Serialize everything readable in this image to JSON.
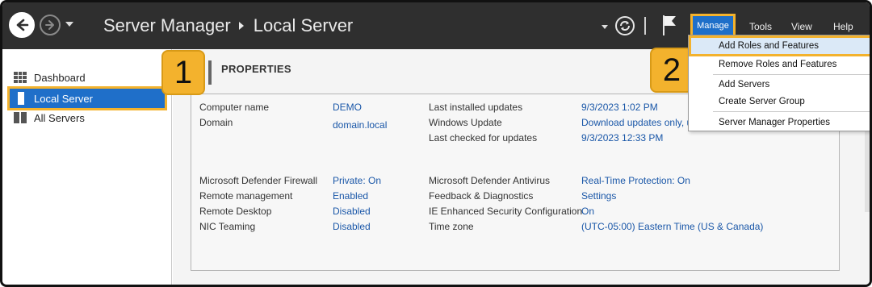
{
  "titlebar": {
    "breadcrumb_root": "Server Manager",
    "breadcrumb_current": "Local Server",
    "menus": {
      "manage": "Manage",
      "tools": "Tools",
      "view": "View",
      "help": "Help"
    },
    "icons": [
      "back-arrow-icon",
      "forward-arrow-icon",
      "refresh-icon",
      "flag-icon"
    ]
  },
  "sidebar": {
    "items": [
      {
        "label": "Dashboard",
        "icon": "dashboard-grid-icon"
      },
      {
        "label": "Local Server",
        "icon": "local-server-icon",
        "selected": true
      },
      {
        "label": "All Servers",
        "icon": "all-servers-icon"
      }
    ]
  },
  "callouts": {
    "one": "1",
    "two": "2"
  },
  "properties": {
    "title": "PROPERTIES",
    "left_top": [
      {
        "label": "Computer name",
        "value": "DEMO"
      },
      {
        "label": "Domain",
        "value": "domain.local"
      }
    ],
    "right_top": [
      {
        "label": "Last installed updates",
        "value": "9/3/2023 1:02 PM"
      },
      {
        "label": "Windows Update",
        "value": "Download updates only, u"
      },
      {
        "label": "Last checked for updates",
        "value": "9/3/2023 12:33 PM"
      }
    ],
    "left_bottom": [
      {
        "label": "Microsoft Defender Firewall",
        "value": "Private: On"
      },
      {
        "label": "Remote management",
        "value": "Enabled"
      },
      {
        "label": "Remote Desktop",
        "value": "Disabled"
      },
      {
        "label": "NIC Teaming",
        "value": "Disabled"
      }
    ],
    "right_bottom": [
      {
        "label": "Microsoft Defender Antivirus",
        "value": "Real-Time Protection: On"
      },
      {
        "label": "Feedback & Diagnostics",
        "value": "Settings"
      },
      {
        "label": "IE Enhanced Security Configuration",
        "value": "On"
      },
      {
        "label": "Time zone",
        "value": "(UTC-05:00) Eastern Time (US & Canada)"
      }
    ]
  },
  "manage_menu": {
    "items": [
      "Add Roles and Features",
      "Remove Roles and Features",
      "Add Servers",
      "Create Server Group",
      "Server Manager Properties"
    ]
  },
  "colors": {
    "titlebar_bg": "#2f2f2f",
    "selection_blue": "#1f6fc9",
    "highlight_orange": "#f3b22d",
    "link_blue": "#1a57a8"
  }
}
